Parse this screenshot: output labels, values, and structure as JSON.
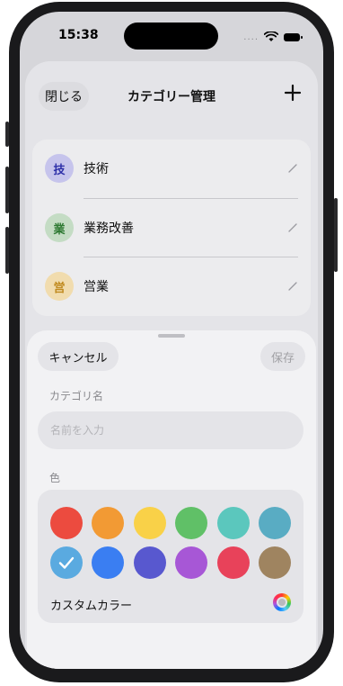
{
  "status_bar": {
    "time": "15:38",
    "signal_dots": "....",
    "wifi_icon": "wifi-icon",
    "battery_icon": "battery-icon"
  },
  "nav": {
    "close_label": "閉じる",
    "title": "カテゴリー管理",
    "add_icon": "plus-icon"
  },
  "categories": [
    {
      "badge": "技",
      "name": "技術",
      "badge_bg": "#c6c4ec",
      "badge_fg": "#2d2fa8",
      "edit_icon": "pencil-icon"
    },
    {
      "badge": "業",
      "name": "業務改善",
      "badge_bg": "#c4dcc4",
      "badge_fg": "#2f7a34",
      "edit_icon": "pencil-icon"
    },
    {
      "badge": "営",
      "name": "営業",
      "badge_bg": "#f1dcae",
      "badge_fg": "#c08a1e",
      "edit_icon": "pencil-icon"
    }
  ],
  "sheet": {
    "cancel_label": "キャンセル",
    "save_label": "保存",
    "name_section_label": "カテゴリ名",
    "name_value": "",
    "name_placeholder": "名前を入力",
    "color_section_label": "色",
    "colors": [
      "#ec4b3f",
      "#f29a34",
      "#f9d148",
      "#60c067",
      "#5bc7bd",
      "#59acc3",
      "#5aaae0",
      "#3a7ef2",
      "#5858cf",
      "#a757d6",
      "#e8425a",
      "#9f8460"
    ],
    "selected_color_index": 6,
    "custom_color_label": "カスタムカラー",
    "custom_color_icon": "color-wheel-icon"
  }
}
